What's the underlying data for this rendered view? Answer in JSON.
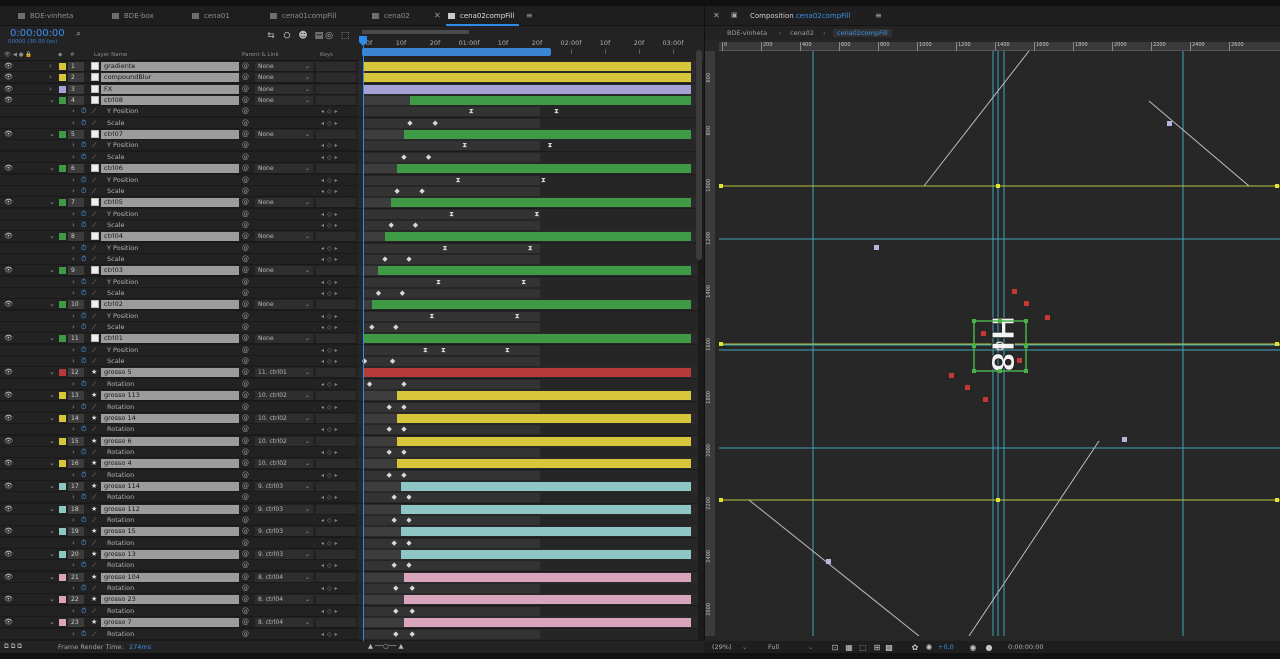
{
  "tabs": [
    {
      "label": "BDE-vinheta",
      "active": false
    },
    {
      "label": "BDE-box",
      "active": false
    },
    {
      "label": "cena01",
      "active": false
    },
    {
      "label": "cena01compFill",
      "active": false
    },
    {
      "label": "cena02",
      "active": false
    },
    {
      "label": "cena02compFill",
      "active": true
    }
  ],
  "timeline": {
    "timecode": "0:00:00:00",
    "fps": "00000 (30.00 fps)",
    "columns": {
      "layer_name": "Layer Name",
      "parent": "Parent & Link",
      "keys": "Keys"
    },
    "ruler_labels": [
      "00f",
      "10f",
      "20f",
      "01:00f",
      "10f",
      "20f",
      "02:00f",
      "10f",
      "20f",
      "03:00f"
    ],
    "status_label": "Frame Render Time:",
    "render_time": "274ms"
  },
  "colors": {
    "accent": "#2d8ceb",
    "yellow": "#d7c63a",
    "lavender": "#a7a2d6",
    "green": "#3f9a45",
    "red": "#b53a3a",
    "cyan": "#8ec6c6",
    "pink": "#d9a5bd"
  },
  "rows": [
    {
      "type": "layer",
      "n": "1",
      "name": "gradiente",
      "parent": "None",
      "label": "yellow",
      "tw": false,
      "icon": "box",
      "bar": "yellow",
      "start": 0.0
    },
    {
      "type": "layer",
      "n": "2",
      "name": "compoundBlur",
      "parent": "None",
      "label": "yellow",
      "tw": false,
      "icon": "box",
      "bar": "yellow",
      "start": 0.0
    },
    {
      "type": "layer",
      "n": "3",
      "name": "FX",
      "parent": "None",
      "label": "lavender",
      "tw": false,
      "icon": "box",
      "bar": "lavender",
      "start": 0.0
    },
    {
      "type": "layer",
      "n": "4",
      "name": "ctrl08",
      "parent": "None",
      "label": "green",
      "tw": true,
      "icon": "box",
      "bar": "green",
      "start": 0.143
    },
    {
      "type": "prop",
      "name": "Y Position",
      "kf": [
        0.33,
        0.59
      ]
    },
    {
      "type": "prop",
      "name": "Scale",
      "kf": [
        0.143,
        0.22
      ]
    },
    {
      "type": "layer",
      "n": "5",
      "name": "ctrl07",
      "parent": "None",
      "label": "green",
      "tw": true,
      "icon": "box",
      "bar": "green",
      "start": 0.125
    },
    {
      "type": "prop",
      "name": "Y Position",
      "kf": [
        0.31,
        0.57
      ]
    },
    {
      "type": "prop",
      "name": "Scale",
      "kf": [
        0.125,
        0.2
      ]
    },
    {
      "type": "layer",
      "n": "6",
      "name": "ctrl06",
      "parent": "None",
      "label": "green",
      "tw": true,
      "icon": "box",
      "bar": "green",
      "start": 0.104
    },
    {
      "type": "prop",
      "name": "Y Position",
      "kf": [
        0.29,
        0.55
      ]
    },
    {
      "type": "prop",
      "name": "Scale",
      "kf": [
        0.104,
        0.18
      ]
    },
    {
      "type": "layer",
      "n": "7",
      "name": "ctrl05",
      "parent": "None",
      "label": "green",
      "tw": true,
      "icon": "box",
      "bar": "green",
      "start": 0.086
    },
    {
      "type": "prop",
      "name": "Y Position",
      "kf": [
        0.27,
        0.53
      ]
    },
    {
      "type": "prop",
      "name": "Scale",
      "kf": [
        0.086,
        0.16
      ]
    },
    {
      "type": "layer",
      "n": "8",
      "name": "ctrl04",
      "parent": "None",
      "label": "green",
      "tw": true,
      "icon": "box",
      "bar": "green",
      "start": 0.067
    },
    {
      "type": "prop",
      "name": "Y Position",
      "kf": [
        0.25,
        0.51
      ]
    },
    {
      "type": "prop",
      "name": "Scale",
      "kf": [
        0.067,
        0.14
      ]
    },
    {
      "type": "layer",
      "n": "9",
      "name": "ctrl03",
      "parent": "None",
      "label": "green",
      "tw": true,
      "icon": "box",
      "bar": "green",
      "start": 0.047
    },
    {
      "type": "prop",
      "name": "Y Position",
      "kf": [
        0.23,
        0.49
      ]
    },
    {
      "type": "prop",
      "name": "Scale",
      "kf": [
        0.047,
        0.12
      ]
    },
    {
      "type": "layer",
      "n": "10",
      "name": "ctrl02",
      "parent": "None",
      "label": "green",
      "tw": true,
      "icon": "box",
      "bar": "green",
      "start": 0.027
    },
    {
      "type": "prop",
      "name": "Y Position",
      "kf": [
        0.21,
        0.47
      ]
    },
    {
      "type": "prop",
      "name": "Scale",
      "kf": [
        0.027,
        0.1
      ]
    },
    {
      "type": "layer",
      "n": "11",
      "name": "ctrl01",
      "parent": "None",
      "label": "green",
      "tw": true,
      "icon": "box",
      "bar": "green",
      "start": 0.0
    },
    {
      "type": "prop",
      "name": "Y Position",
      "kf": [
        0.19,
        0.245,
        0.44
      ]
    },
    {
      "type": "prop",
      "name": "Scale",
      "kf": [
        0.005,
        0.09
      ]
    },
    {
      "type": "layer",
      "n": "12",
      "name": "grosso 5",
      "parent": "11. ctrl01",
      "label": "red",
      "tw": true,
      "icon": "star",
      "bar": "red",
      "start": 0.0
    },
    {
      "type": "prop",
      "name": "Rotation",
      "kf": [
        0.02,
        0.125
      ]
    },
    {
      "type": "layer",
      "n": "13",
      "name": "grosso 113",
      "parent": "10. ctrl02",
      "label": "yellow",
      "tw": true,
      "icon": "star",
      "bar": "yellow",
      "start": 0.104
    },
    {
      "type": "prop",
      "name": "Rotation",
      "kf": [
        0.08,
        0.125
      ]
    },
    {
      "type": "layer",
      "n": "14",
      "name": "grosso 14",
      "parent": "10. ctrl02",
      "label": "yellow",
      "tw": true,
      "icon": "star",
      "bar": "yellow",
      "start": 0.104
    },
    {
      "type": "prop",
      "name": "Rotation",
      "kf": [
        0.08,
        0.125
      ]
    },
    {
      "type": "layer",
      "n": "15",
      "name": "grosso 6",
      "parent": "10. ctrl02",
      "label": "yellow",
      "tw": true,
      "icon": "star",
      "bar": "yellow",
      "start": 0.104
    },
    {
      "type": "prop",
      "name": "Rotation",
      "kf": [
        0.08,
        0.125
      ]
    },
    {
      "type": "layer",
      "n": "16",
      "name": "grosso 4",
      "parent": "10. ctrl02",
      "label": "yellow",
      "tw": true,
      "icon": "star",
      "bar": "yellow",
      "start": 0.104
    },
    {
      "type": "prop",
      "name": "Rotation",
      "kf": [
        0.08,
        0.125
      ]
    },
    {
      "type": "layer",
      "n": "17",
      "name": "grosso 114",
      "parent": "9. ctrl03",
      "label": "cyan",
      "tw": true,
      "icon": "star",
      "bar": "cyan",
      "start": 0.115
    },
    {
      "type": "prop",
      "name": "Rotation",
      "kf": [
        0.095,
        0.14
      ]
    },
    {
      "type": "layer",
      "n": "18",
      "name": "grosso 112",
      "parent": "9. ctrl03",
      "label": "cyan",
      "tw": true,
      "icon": "star",
      "bar": "cyan",
      "start": 0.115
    },
    {
      "type": "prop",
      "name": "Rotation",
      "kf": [
        0.095,
        0.14
      ]
    },
    {
      "type": "layer",
      "n": "19",
      "name": "grosso 15",
      "parent": "9. ctrl03",
      "label": "cyan",
      "tw": true,
      "icon": "star",
      "bar": "cyan",
      "start": 0.115
    },
    {
      "type": "prop",
      "name": "Rotation",
      "kf": [
        0.095,
        0.14
      ]
    },
    {
      "type": "layer",
      "n": "20",
      "name": "grosso 13",
      "parent": "9. ctrl03",
      "label": "cyan",
      "tw": true,
      "icon": "star",
      "bar": "cyan",
      "start": 0.115
    },
    {
      "type": "prop",
      "name": "Rotation",
      "kf": [
        0.095,
        0.14
      ]
    },
    {
      "type": "layer",
      "n": "21",
      "name": "grosso 104",
      "parent": "8. ctrl04",
      "label": "pink",
      "tw": true,
      "icon": "star",
      "bar": "pink",
      "start": 0.125
    },
    {
      "type": "prop",
      "name": "Rotation",
      "kf": [
        0.1,
        0.15
      ]
    },
    {
      "type": "layer",
      "n": "22",
      "name": "grosso 23",
      "parent": "8. ctrl04",
      "label": "pink",
      "tw": true,
      "icon": "star",
      "bar": "pink",
      "start": 0.125
    },
    {
      "type": "prop",
      "name": "Rotation",
      "kf": [
        0.1,
        0.15
      ]
    },
    {
      "type": "layer",
      "n": "23",
      "name": "grosso 7",
      "parent": "8. ctrl04",
      "label": "pink",
      "tw": true,
      "icon": "star",
      "bar": "pink",
      "start": 0.125
    },
    {
      "type": "prop",
      "name": "Rotation",
      "kf": [
        0.1,
        0.15
      ]
    }
  ],
  "composition": {
    "panel_label": "Composition",
    "name": "cena02compFill",
    "breadcrumbs": [
      "BDE-vinheta",
      "cena02",
      "cena02compFill"
    ],
    "ruler_h": [
      "0",
      "200",
      "400",
      "600",
      "800",
      "1000",
      "1200",
      "1400",
      "1600",
      "1800",
      "2000",
      "2200",
      "2400",
      "2600"
    ],
    "ruler_v": [
      "600",
      "800",
      "1000",
      "1200",
      "1400",
      "1600",
      "1800",
      "2000",
      "2200",
      "2400",
      "2600"
    ],
    "text": "HI8",
    "zoom": "(29%)",
    "quality": "Full",
    "exposure": "+0,0",
    "time": "0:00:00:00"
  }
}
